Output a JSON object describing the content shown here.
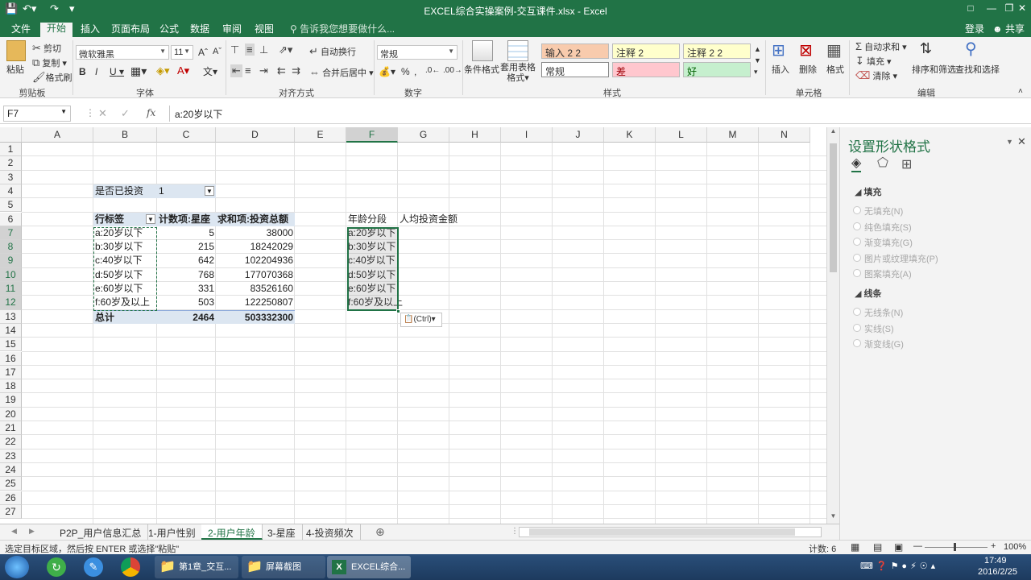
{
  "window": {
    "title": "EXCEL综合实操案例-交互课件.xlsx - Excel"
  },
  "tabs": [
    "文件",
    "开始",
    "插入",
    "页面布局",
    "公式",
    "数据",
    "审阅",
    "视图"
  ],
  "tell_me": "告诉我您想要做什么...",
  "account": {
    "login": "登录",
    "share": "共享"
  },
  "ribbon": {
    "clipboard": {
      "paste": "粘贴",
      "cut": "剪切",
      "copy": "复制",
      "format_painter": "格式刷",
      "label": "剪贴板"
    },
    "font": {
      "name": "微软雅黑",
      "size": "11",
      "label": "字体",
      "bold": "B",
      "italic": "I",
      "underline": "U"
    },
    "alignment": {
      "wrap": "自动换行",
      "merge": "合并后居中",
      "label": "对齐方式"
    },
    "number": {
      "format": "常规",
      "label": "数字"
    },
    "styles": {
      "conditional": "条件格式",
      "table_format": "套用表格格式",
      "cells": [
        "输入 2 2",
        "注释 2",
        "注释 2 2",
        "常规",
        "差",
        "好"
      ],
      "label": "样式"
    },
    "cells": {
      "insert": "插入",
      "delete": "删除",
      "format": "格式",
      "label": "单元格"
    },
    "editing": {
      "autosum": "自动求和",
      "fill": "填充",
      "clear": "清除",
      "sort": "排序和筛选",
      "find": "查找和选择",
      "label": "编辑"
    }
  },
  "formula_bar": {
    "name_box": "F7",
    "value": "a:20岁以下",
    "fx": "fx"
  },
  "columns": [
    "A",
    "B",
    "C",
    "D",
    "E",
    "F",
    "G",
    "H",
    "I",
    "J",
    "K",
    "L",
    "M",
    "N"
  ],
  "rows": [
    "1",
    "2",
    "3",
    "4",
    "5",
    "6",
    "7",
    "8",
    "9",
    "10",
    "11",
    "12",
    "13",
    "14",
    "15",
    "16",
    "17",
    "18",
    "19",
    "20",
    "21",
    "22",
    "23",
    "24",
    "25",
    "26",
    "27"
  ],
  "pivot": {
    "filter_label": "是否已投资",
    "filter_value": "1",
    "headers": [
      "行标签",
      "计数项:星座",
      "求和项:投资总额"
    ],
    "rows": [
      [
        "a:20岁以下",
        "5",
        "38000"
      ],
      [
        "b:30岁以下",
        "215",
        "18242029"
      ],
      [
        "c:40岁以下",
        "642",
        "102204936"
      ],
      [
        "d:50岁以下",
        "768",
        "177070368"
      ],
      [
        "e:60岁以下",
        "331",
        "83526160"
      ],
      [
        "f:60岁及以上",
        "503",
        "122250807"
      ]
    ],
    "total": [
      "总计",
      "2464",
      "503332300"
    ]
  },
  "side_table": {
    "headers": [
      "年龄分段",
      "人均投资金额"
    ],
    "rows": [
      "a:20岁以下",
      "b:30岁以下",
      "c:40岁以下",
      "d:50岁以下",
      "e:60岁以下",
      "f:60岁及以上"
    ]
  },
  "paste_options": "(Ctrl)",
  "sheets": [
    "P2P_用户信息汇总",
    "1-用户性别",
    "2-用户年龄",
    "3-星座",
    "4-投资频次"
  ],
  "active_sheet": 2,
  "status": {
    "message": "选定目标区域，然后按 ENTER 或选择\"粘贴\"",
    "count": "计数: 6",
    "zoom": "100%"
  },
  "pane": {
    "title": "设置形状格式",
    "fill_section": "填充",
    "fill_options": [
      "无填充(N)",
      "纯色填充(S)",
      "渐变填充(G)",
      "图片或纹理填充(P)",
      "图案填充(A)"
    ],
    "line_section": "线条",
    "line_options": [
      "无线条(N)",
      "实线(S)",
      "渐变线(G)"
    ]
  },
  "taskbar": {
    "items": [
      "第1章_交互...",
      "屏幕截图",
      "EXCEL综合..."
    ],
    "time": "17:49",
    "date": "2016/2/25"
  },
  "colors": {
    "excel_green": "#217346",
    "selection": "#217346",
    "pivot_header": "#dce6f1"
  }
}
